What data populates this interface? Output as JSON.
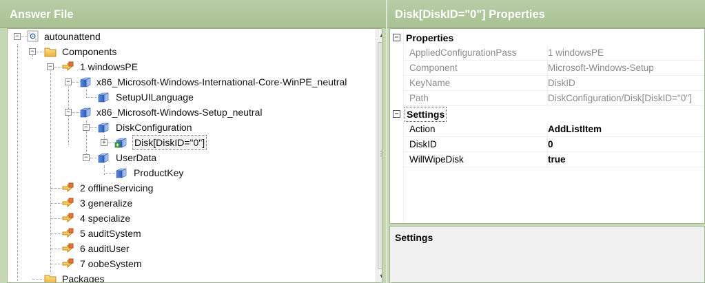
{
  "answer_file_pane": {
    "title": "Answer File",
    "tree": [
      {
        "label": "autounattend",
        "icon": "answer-file-icon"
      },
      {
        "label": "Components",
        "icon": "folder-icon"
      },
      {
        "label": "1 windowsPE",
        "icon": "config-pass-icon"
      },
      {
        "label": "x86_Microsoft-Windows-International-Core-WinPE_neutral",
        "icon": "component-cube-icon"
      },
      {
        "label": "SetupUILanguage",
        "icon": "component-cube-icon"
      },
      {
        "label": "x86_Microsoft-Windows-Setup_neutral",
        "icon": "component-cube-icon"
      },
      {
        "label": "DiskConfiguration",
        "icon": "component-cube-icon"
      },
      {
        "label": "Disk[DiskID=\"0\"]",
        "icon": "list-item-cube-icon"
      },
      {
        "label": "UserData",
        "icon": "component-cube-icon"
      },
      {
        "label": "ProductKey",
        "icon": "component-cube-icon"
      },
      {
        "label": "2 offlineServicing",
        "icon": "config-pass-icon"
      },
      {
        "label": "3 generalize",
        "icon": "config-pass-icon"
      },
      {
        "label": "4 specialize",
        "icon": "config-pass-icon"
      },
      {
        "label": "5 auditSystem",
        "icon": "config-pass-icon"
      },
      {
        "label": "6 auditUser",
        "icon": "config-pass-icon"
      },
      {
        "label": "7 oobeSystem",
        "icon": "config-pass-icon"
      },
      {
        "label": "Packages",
        "icon": "folder-icon"
      }
    ],
    "expander_minus": "−",
    "expander_plus": "+"
  },
  "properties_pane": {
    "title": "Disk[DiskID=\"0\"] Properties",
    "toggle_symbol": "−",
    "categories": [
      {
        "label": "Properties",
        "rows": [
          {
            "name": "AppliedConfigurationPass",
            "value": "1 windowsPE"
          },
          {
            "name": "Component",
            "value": "Microsoft-Windows-Setup"
          },
          {
            "name": "KeyName",
            "value": "DiskID"
          },
          {
            "name": "Path",
            "value": "DiskConfiguration/Disk[DiskID=\"0\"]"
          }
        ]
      },
      {
        "label": "Settings",
        "rows": [
          {
            "name": "Action",
            "value": "AddListItem"
          },
          {
            "name": "DiskID",
            "value": "0"
          },
          {
            "name": "WillWipeDisk",
            "value": "true"
          }
        ]
      }
    ],
    "description_title": "Settings"
  },
  "colors": {
    "pane_background": "#c5d7b4",
    "title_text": "#ffffff",
    "readonly_text": "#8c8c8c",
    "folder_yellow": "#f2c04a",
    "cube_blue": "#3b6fc4"
  },
  "scrollbar": {
    "up_arrow": "▲",
    "down_arrow": "▼"
  }
}
